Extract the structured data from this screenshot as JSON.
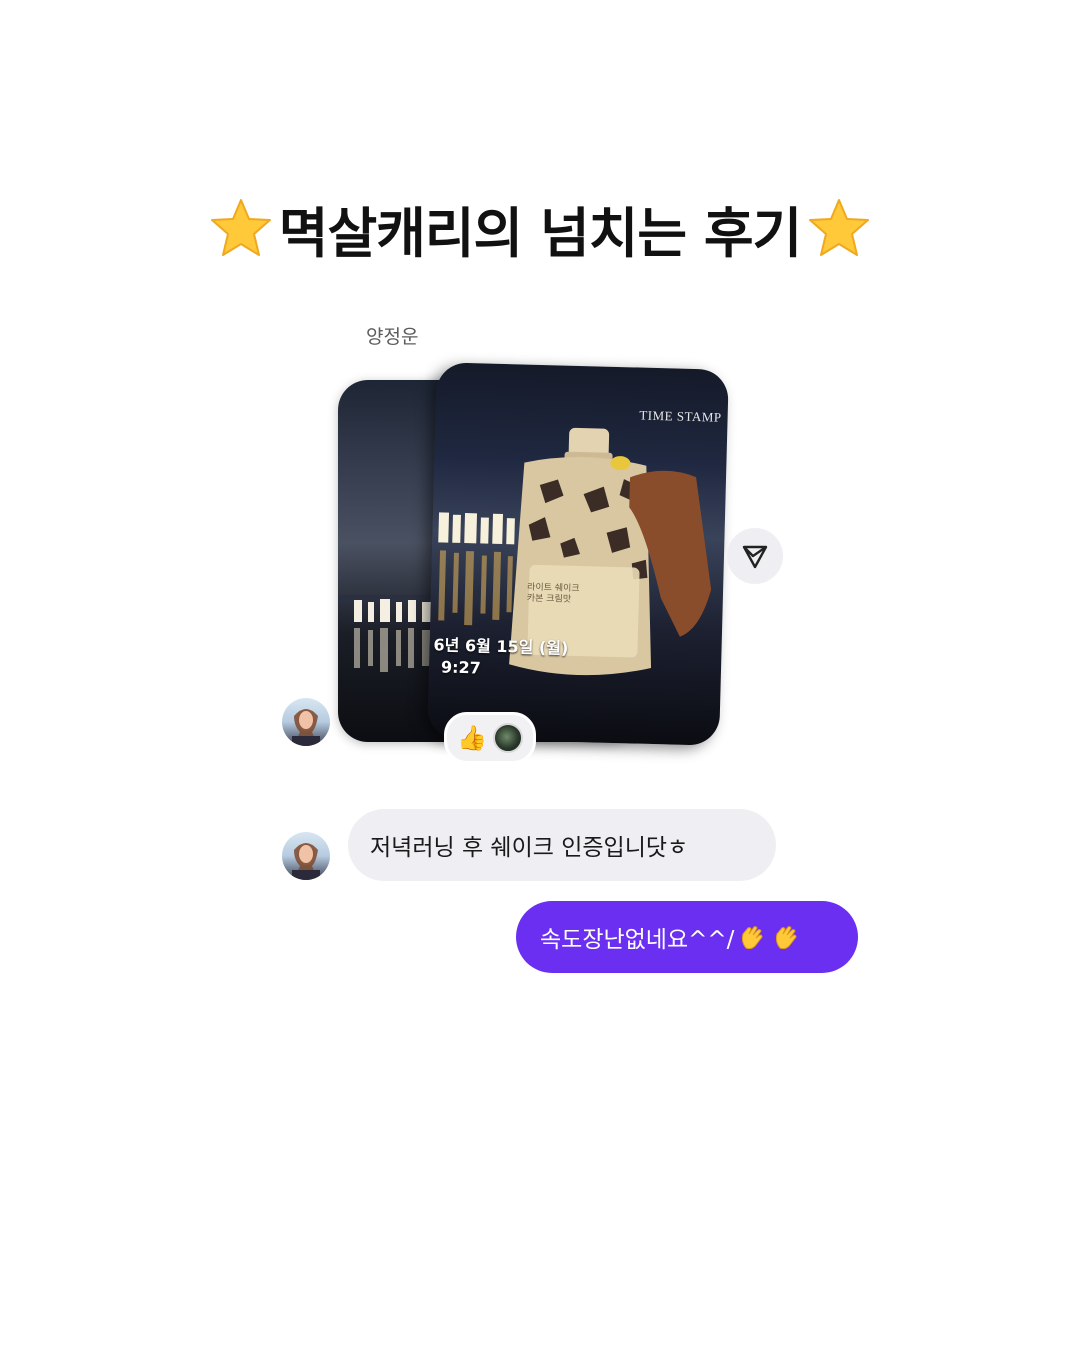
{
  "headline": {
    "text": "멱살캐리의 넘치는 후기",
    "decoration_icon": "star-icon"
  },
  "chat": {
    "sender_name": "양정운",
    "photo": {
      "watermark": "TIME STAMP",
      "date_text": "6년 6월 15일 (월)",
      "time_text": "9:27",
      "pouch_text": "라이트 쉐이크\n카본 크림맛"
    },
    "reactions": [
      "thumbs-up-icon",
      "photo-reaction"
    ],
    "share_icon": "send-icon",
    "messages": [
      {
        "direction": "incoming",
        "text": "저녁러닝 후 쉐이크 인증입니닷ㅎ"
      },
      {
        "direction": "outgoing",
        "text": "속도장난없네요^^/",
        "emoji": "clapping-hands-icon"
      }
    ]
  },
  "colors": {
    "outgoing_bubble": "#6a2ff0",
    "incoming_bubble": "#efeff3",
    "star": "#ffc93a"
  }
}
